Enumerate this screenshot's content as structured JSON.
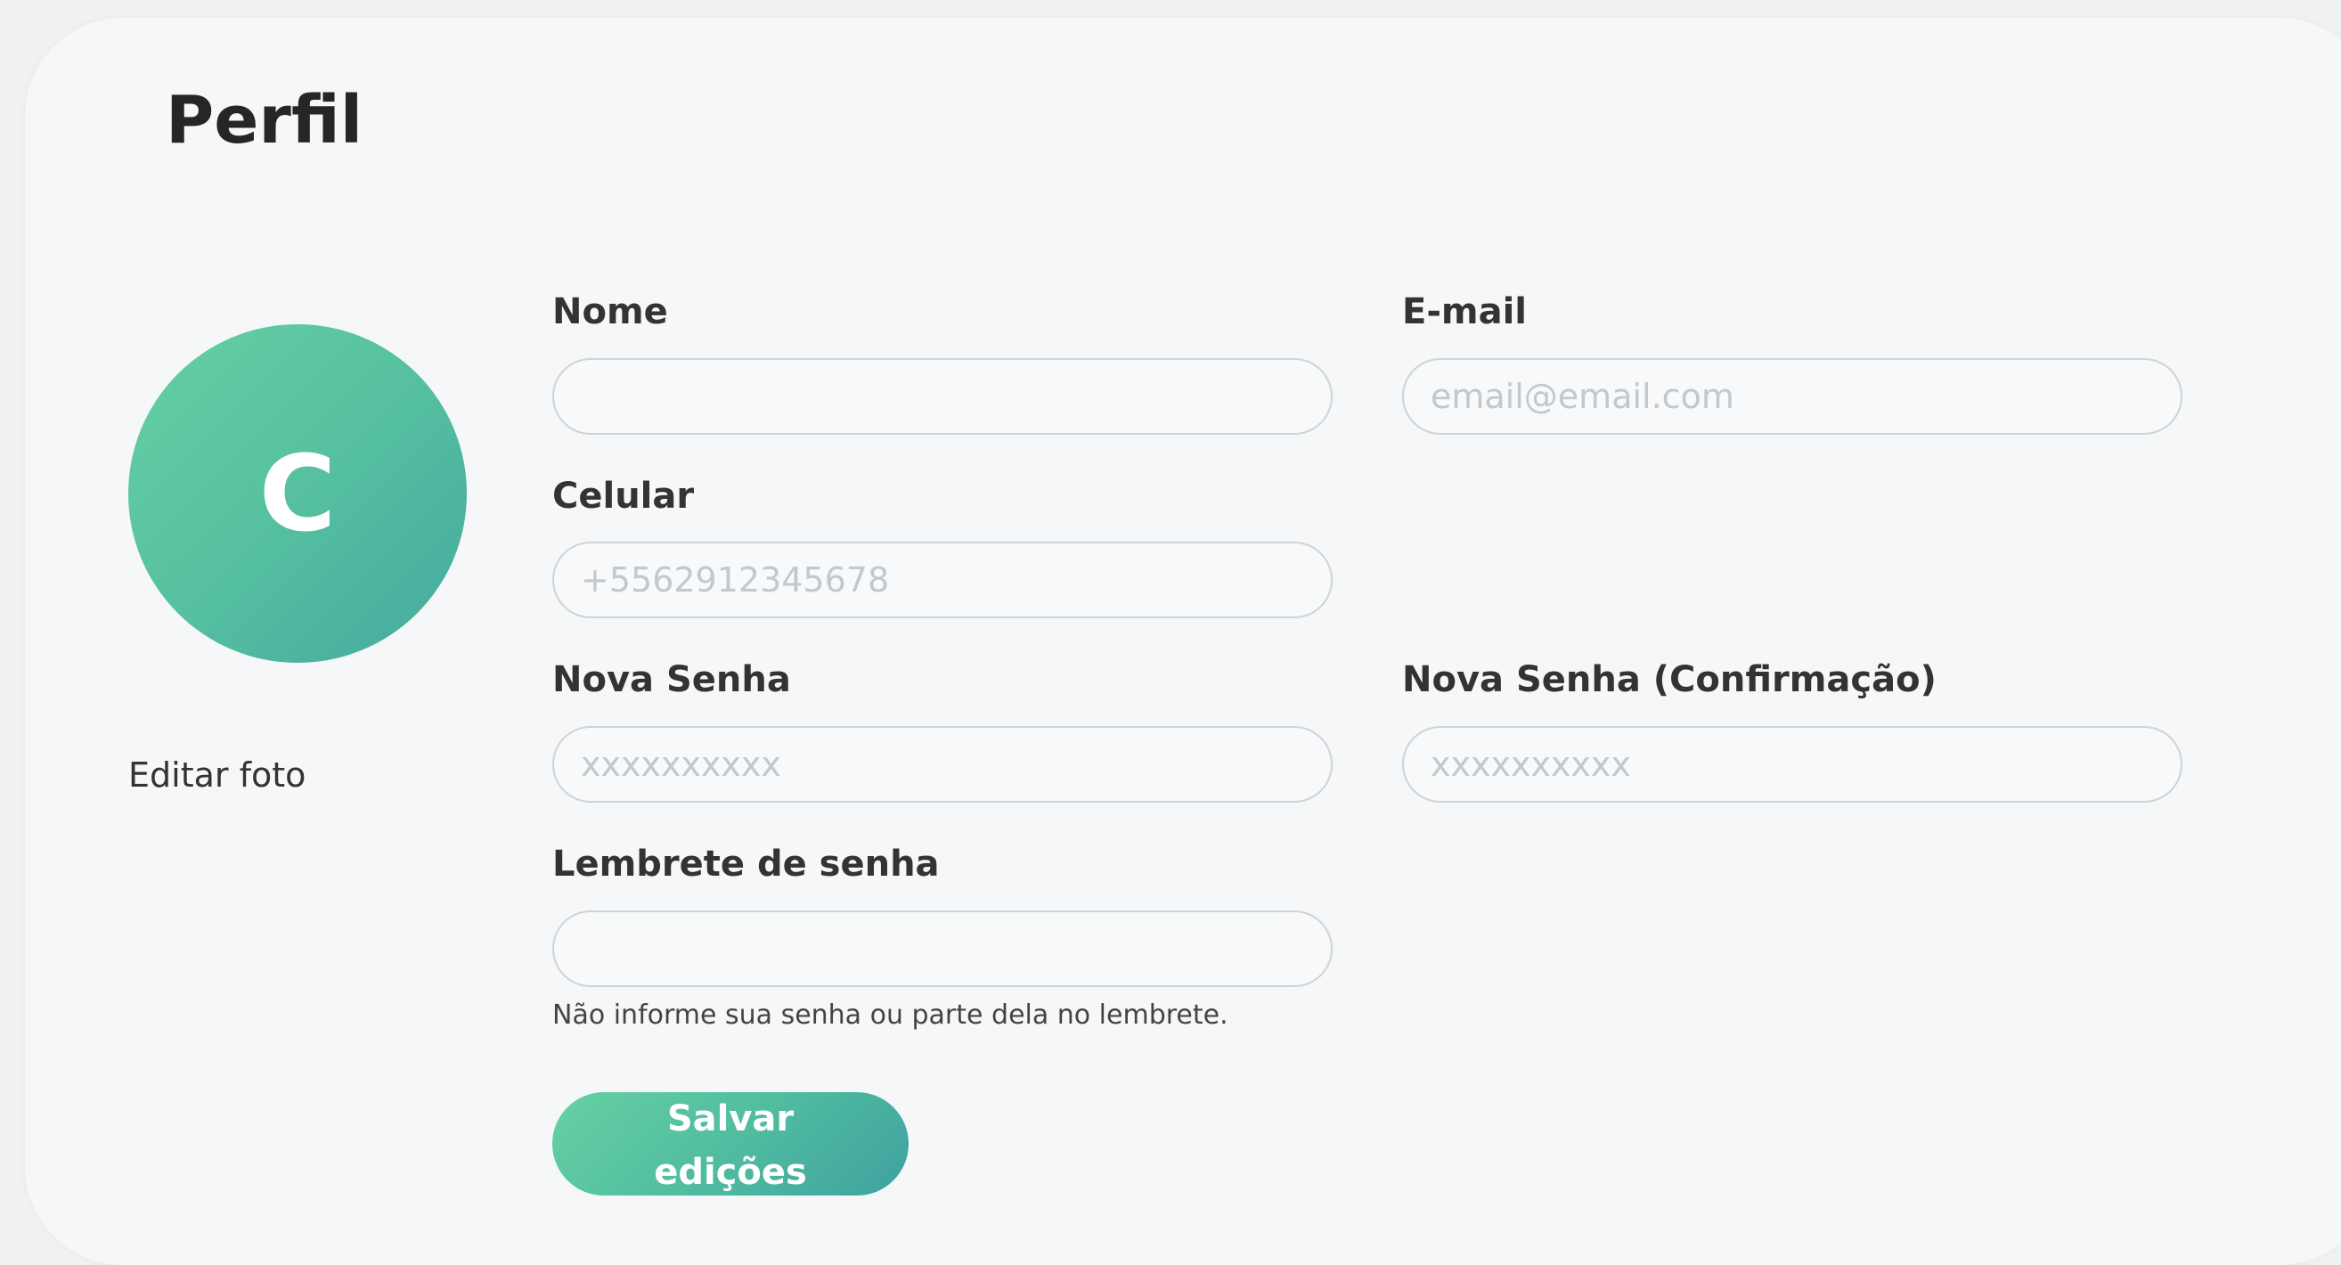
{
  "page": {
    "title": "Perfil"
  },
  "avatar": {
    "initial": "C",
    "edit_label": "Editar foto"
  },
  "form": {
    "name": {
      "label": "Nome",
      "value": "",
      "placeholder": ""
    },
    "email": {
      "label": "E-mail",
      "value": "",
      "placeholder": "email@email.com"
    },
    "phone": {
      "label": "Celular",
      "value": "",
      "placeholder": "+5562912345678"
    },
    "new_password": {
      "label": "Nova Senha",
      "value": "",
      "placeholder": "xxxxxxxxxx"
    },
    "confirm_password": {
      "label": "Nova Senha (Confirmação)",
      "value": "",
      "placeholder": "xxxxxxxxxx"
    },
    "password_hint": {
      "label": "Lembrete de senha",
      "value": "",
      "placeholder": ""
    },
    "hint_text": "Não informe sua senha ou parte dela no lembrete.",
    "save_label": "Salvar edições"
  },
  "colors": {
    "accent_start": "#66d1a3",
    "accent_end": "#3fa1a0"
  }
}
